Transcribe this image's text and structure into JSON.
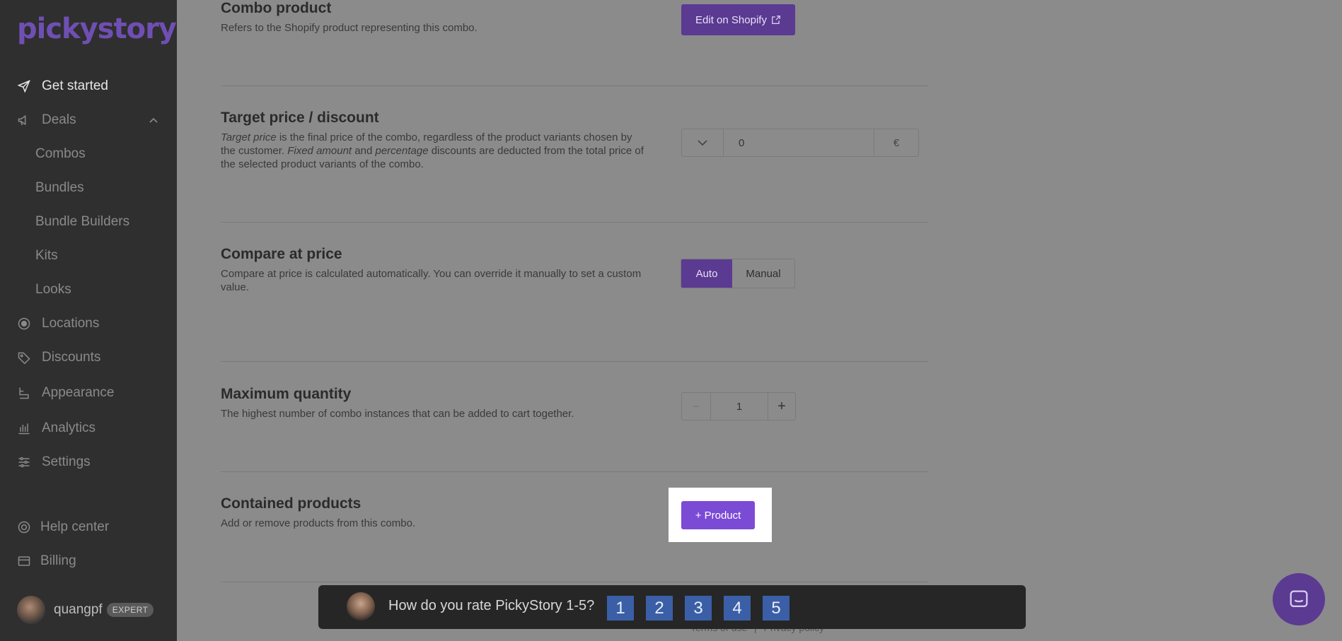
{
  "brand": {
    "logo": "pickystory"
  },
  "sidebar": {
    "items": [
      {
        "label": "Get started",
        "icon": "send-icon"
      },
      {
        "label": "Deals",
        "icon": "megaphone-icon"
      },
      {
        "label": "Combos"
      },
      {
        "label": "Bundles"
      },
      {
        "label": "Bundle Builders"
      },
      {
        "label": "Kits"
      },
      {
        "label": "Looks"
      },
      {
        "label": "Locations",
        "icon": "target-icon"
      },
      {
        "label": "Discounts",
        "icon": "tag-icon"
      },
      {
        "label": "Appearance",
        "icon": "brush-icon"
      },
      {
        "label": "Analytics",
        "icon": "bar-chart-icon"
      },
      {
        "label": "Settings",
        "icon": "sliders-icon"
      },
      {
        "label": "Help center",
        "icon": "lifebuoy-icon"
      },
      {
        "label": "Billing",
        "icon": "card-icon"
      }
    ],
    "user": {
      "name": "quangpf",
      "badge": "EXPERT"
    }
  },
  "sections": {
    "combo_product": {
      "title": "Combo product",
      "desc": "Refers to the Shopify product representing this combo.",
      "button": "Edit on Shopify"
    },
    "target_price": {
      "title": "Target price / discount",
      "desc_1": "Target price",
      "desc_2": " is the final price of the combo, regardless of the product variants chosen by the customer. ",
      "desc_3": "Fixed amount",
      "desc_4": " and ",
      "desc_5": "percentage",
      "desc_6": " discounts are deducted from the total price of the selected product variants of the combo.",
      "value": "0",
      "currency": "€"
    },
    "compare_price": {
      "title": "Compare at price",
      "desc": "Compare at price is calculated automatically. You can override it manually to set a custom value.",
      "options": [
        "Auto",
        "Manual"
      ],
      "selected": "Auto"
    },
    "max_quantity": {
      "title": "Maximum quantity",
      "desc": "The highest number of combo instances that can be added to cart together.",
      "value": "1",
      "minus": "−",
      "plus": "+"
    },
    "contained_products": {
      "title": "Contained products",
      "desc": "Add or remove products from this combo.",
      "button": "+ Product"
    }
  },
  "survey": {
    "question": "How do you rate PickyStory 1-5?",
    "ratings": [
      "1",
      "2",
      "3",
      "4",
      "5"
    ]
  },
  "footer": {
    "terms": "Terms of use",
    "separator": "|",
    "privacy": "Privacy policy"
  },
  "colors": {
    "accent": "#7b4bd6",
    "sidebar_bg": "#2f2f2f",
    "rating_bg": "#3b5fa6"
  }
}
